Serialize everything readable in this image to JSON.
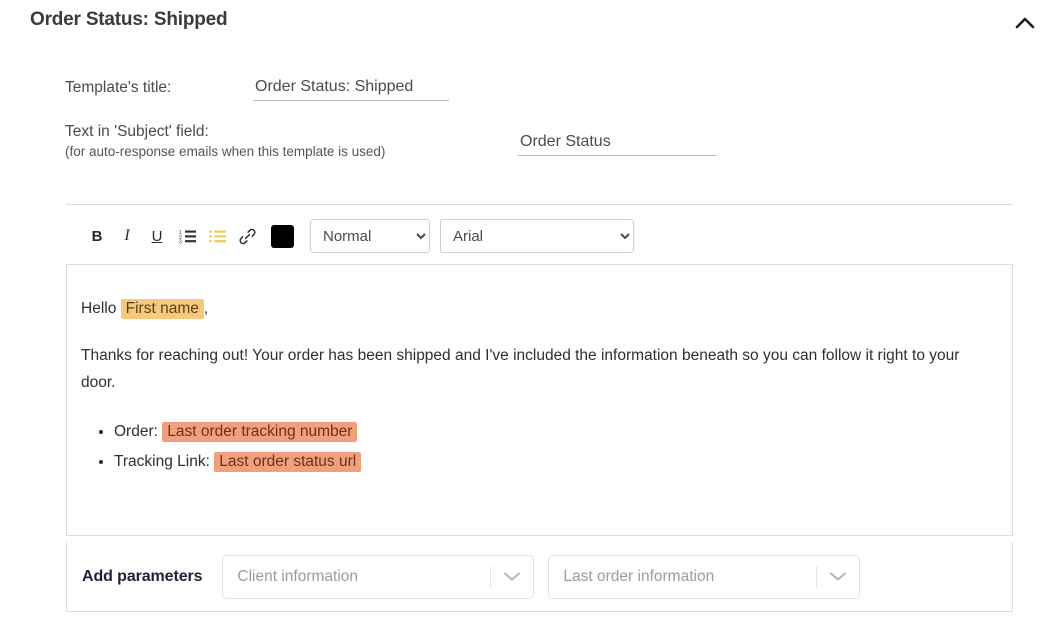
{
  "header": {
    "title": "Order Status: Shipped",
    "collapse_icon": "chevron-up-icon"
  },
  "fields": {
    "title_label": "Template's title:",
    "title_value": "Order Status: Shipped",
    "subject_label": "Text in 'Subject' field:",
    "subject_sublabel": "(for auto-response emails when this template is used)",
    "subject_value": "Order Status"
  },
  "toolbar": {
    "bold_label": "B",
    "italic_label": "I",
    "underline_label": "U",
    "ordered_list_icon": "ordered-list-icon",
    "unordered_list_icon": "unordered-list-icon",
    "link_icon": "link-icon",
    "color_swatch_value": "#000000",
    "heading_selected": "Normal",
    "heading_options": [
      "Normal"
    ],
    "font_selected": "Arial",
    "font_options": [
      "Arial"
    ]
  },
  "editor": {
    "greeting_prefix": "Hello ",
    "greeting_token": "First name",
    "greeting_suffix": ",",
    "paragraph": "Thanks for reaching out! Your order has been shipped and I've included the information beneath so you can follow it right to your door.",
    "list": [
      {
        "label": "Order: ",
        "token": "Last order tracking number"
      },
      {
        "label": "Tracking Link: ",
        "token": "Last order status url"
      }
    ]
  },
  "params": {
    "label": "Add parameters",
    "client_placeholder": "Client information",
    "order_placeholder": "Last order information",
    "dropdown_icon": "chevron-down-icon"
  }
}
